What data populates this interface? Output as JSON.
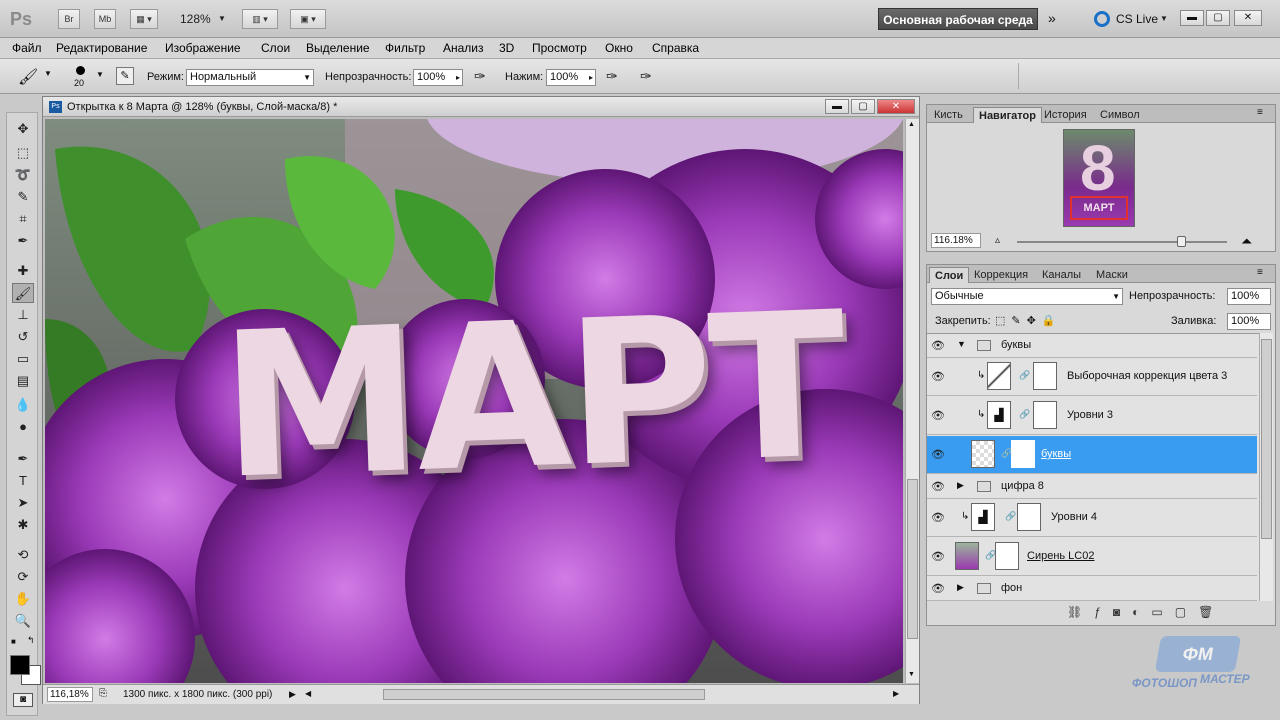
{
  "appbar": {
    "logo": "Ps",
    "br": "Br",
    "mb": "Mb",
    "zoom": "128%",
    "workspace": "Основная рабочая среда",
    "cslive": "CS Live"
  },
  "menu": [
    "Файл",
    "Редактирование",
    "Изображение",
    "Слои",
    "Выделение",
    "Фильтр",
    "Анализ",
    "3D",
    "Просмотр",
    "Окно",
    "Справка"
  ],
  "options": {
    "brush_size": "20",
    "mode_label": "Режим:",
    "mode_value": "Нормальный",
    "opacity_label": "Непрозрачность:",
    "opacity_value": "100%",
    "press_label": "Нажим:",
    "press_value": "100%"
  },
  "document": {
    "title": "Открытка к 8 Марта @ 128% (буквы, Слой-маска/8) *",
    "canvas_text": "МАРТ",
    "status_zoom": "116,18%",
    "status_info": "1300 пикс. x 1800 пикс. (300 ppi)"
  },
  "navigator": {
    "tabs": [
      "Кисть",
      "Навигатор",
      "История",
      "Символ"
    ],
    "active_tab": "Навигатор",
    "thumb_big": "8",
    "thumb_small": "МАРТ",
    "zoom": "116.18%",
    "slider_level": 0.78
  },
  "layers_panel": {
    "tabs": [
      "Слои",
      "Коррекция",
      "Каналы",
      "Маски"
    ],
    "blend": "Обычные",
    "opacity_label": "Непрозрачность:",
    "opacity_value": "100%",
    "lock_label": "Закрепить:",
    "fill_label": "Заливка:",
    "fill_value": "100%",
    "rows": [
      {
        "name": "буквы"
      },
      {
        "name": "Выборочная коррекция цвета 3"
      },
      {
        "name": "Уровни 3"
      },
      {
        "name": "буквы"
      },
      {
        "name": "цифра 8"
      },
      {
        "name": "Уровни 4"
      },
      {
        "name": "Сирень LC02"
      },
      {
        "name": "фон"
      }
    ]
  },
  "watermark": {
    "line1": "ФОТОШОП",
    "line2": "МАСТЕР",
    "badge": "ФМ"
  },
  "colors": {
    "selection": "#3a9cf0",
    "lilac": "#8e2fa5",
    "letters": "#ecd7e2"
  }
}
